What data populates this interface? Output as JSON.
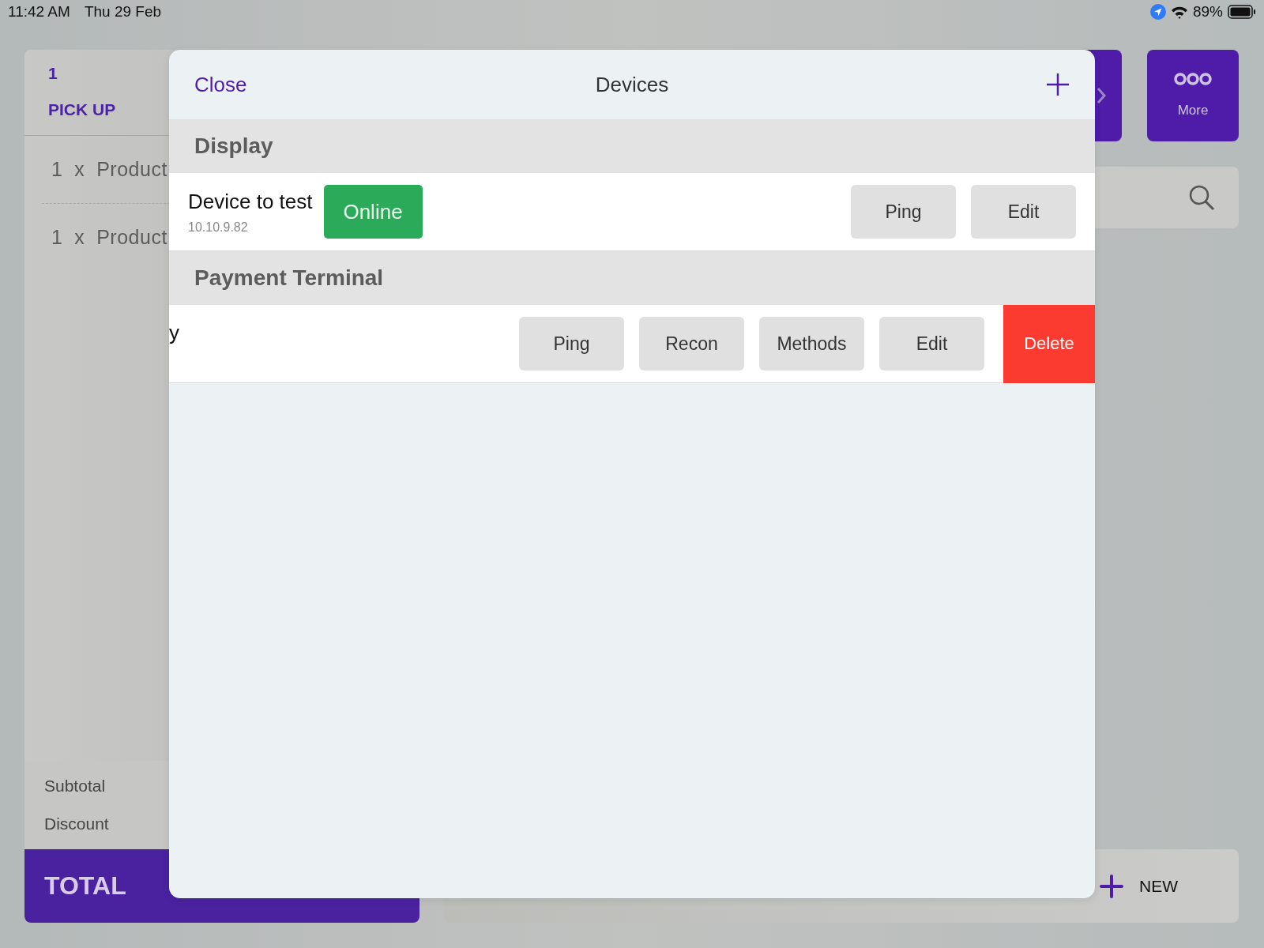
{
  "status_bar": {
    "time": "11:42 AM",
    "date": "Thu 29 Feb",
    "battery_text": "89%"
  },
  "order_panel": {
    "order_number": "1",
    "order_type": "PICK UP",
    "items": [
      {
        "quantity": "1",
        "times": "x",
        "name": "Product"
      },
      {
        "quantity": "1",
        "times": "x",
        "name": "Product"
      }
    ],
    "subtotal_label": "Subtotal",
    "discount_label": "Discount",
    "total_label": "TOTAL"
  },
  "toolbar": {
    "more_label": "More"
  },
  "bottom_bar": {
    "new_label": "NEW"
  },
  "modal": {
    "close": "Close",
    "title": "Devices",
    "sections": [
      {
        "title": "Display",
        "devices": [
          {
            "name": "Device to test",
            "address": "10.10.9.82",
            "status": "Online",
            "actions": [
              "Ping",
              "Edit"
            ],
            "swiped": false
          }
        ]
      },
      {
        "title": "Payment Terminal",
        "devices": [
          {
            "name": "y",
            "actions": [
              "Ping",
              "Recon",
              "Methods",
              "Edit"
            ],
            "swiped": true,
            "delete": "Delete"
          }
        ]
      }
    ]
  }
}
